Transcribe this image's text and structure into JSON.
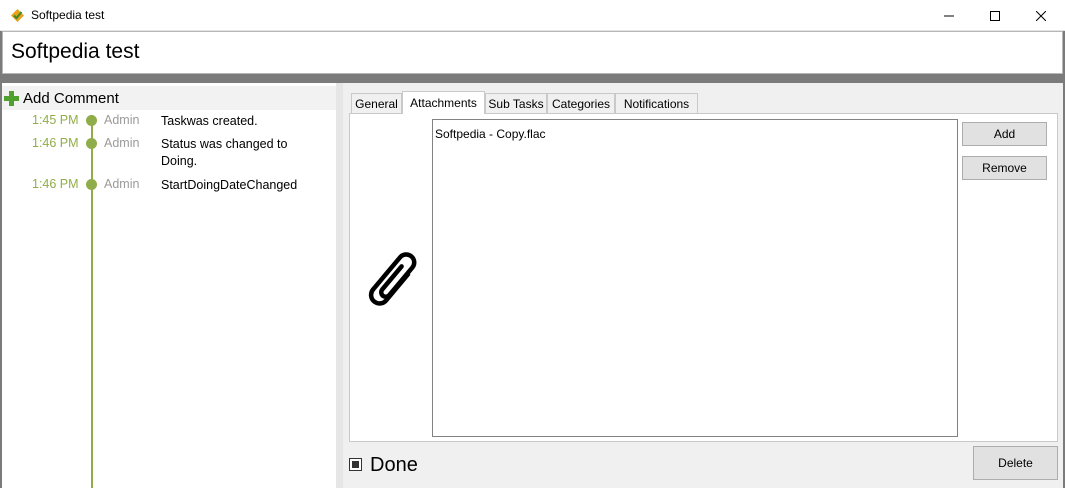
{
  "window": {
    "title": "Softpedia test",
    "controls": [
      "minimize",
      "maximize",
      "close"
    ]
  },
  "task": {
    "name": "Softpedia test"
  },
  "comments": {
    "add_label": "Add Comment",
    "entries": [
      {
        "time": "1:45 PM",
        "user": "Admin",
        "text": "Taskwas created."
      },
      {
        "time": "1:46 PM",
        "user": "Admin",
        "text": "Status was changed to Doing."
      },
      {
        "time": "1:46 PM",
        "user": "Admin",
        "text": "StartDoingDateChanged"
      }
    ]
  },
  "tabs": [
    {
      "label": "General"
    },
    {
      "label": "Attachments",
      "active": true
    },
    {
      "label": "Sub Tasks"
    },
    {
      "label": "Categories"
    },
    {
      "label": "Notifications"
    }
  ],
  "attachments": {
    "files": [
      "Softpedia - Copy.flac"
    ],
    "add_label": "Add",
    "remove_label": "Remove"
  },
  "footer": {
    "done_label": "Done",
    "done_checked": true,
    "delete_label": "Delete"
  },
  "colors": {
    "accent_green": "#8fae4a",
    "frame_gray": "#7b7b7b"
  },
  "icons": {
    "app": "app-logo-icon",
    "add_comment": "plus-icon",
    "attachments": "paperclip-icon"
  }
}
